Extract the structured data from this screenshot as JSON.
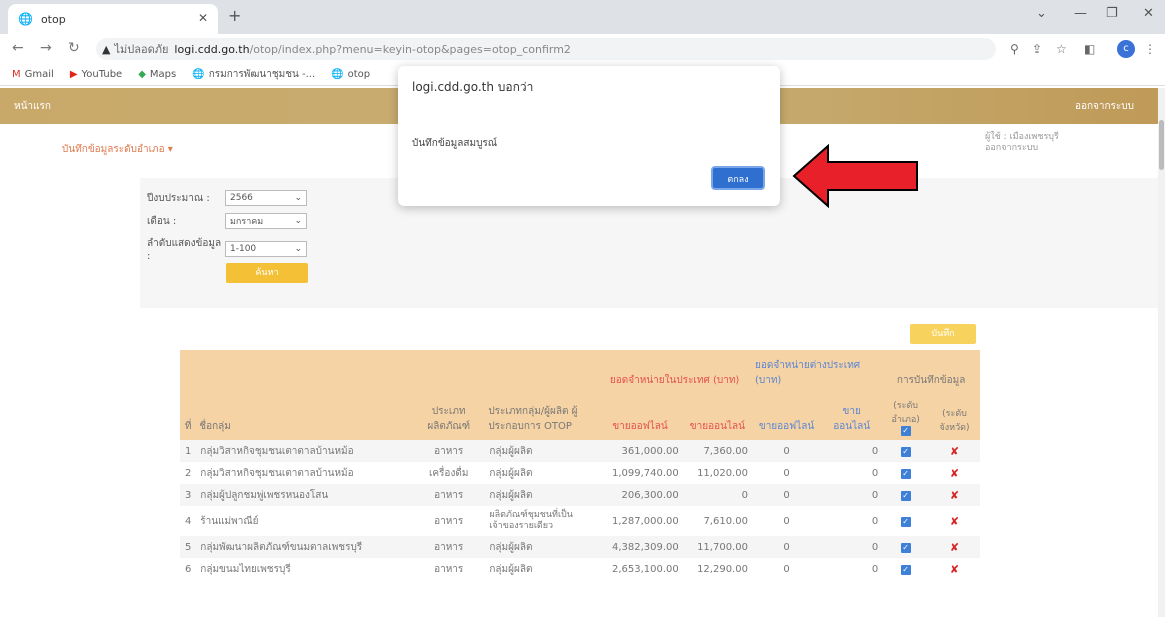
{
  "browser": {
    "tab_title": "otop",
    "url_warning": "ไม่ปลอดภัย",
    "url_domain": "logi.cdd.go.th",
    "url_path": "/otop/index.php?menu=keyin-otop&pages=otop_confirm2",
    "profile_letter": "c",
    "bookmarks": [
      "Gmail",
      "YouTube",
      "Maps",
      "กรมการพัฒนาชุมชน -...",
      "otop"
    ]
  },
  "site": {
    "home_label": "หน้าแรก",
    "logout_label": "ออกจากระบบ",
    "user_line1": "ผู้ใช้ : เมืองเพชรบุรี",
    "user_line2": "ออกจากระบบ",
    "menu_link": "บันทึกข้อมูลระดับอำเภอ ▾"
  },
  "filters": {
    "year_label": "ปีงบประมาณ :",
    "year_value": "2566",
    "month_label": "เดือน :",
    "month_value": "มกราคม",
    "order_label": "ลำดับแสดงข้อมูล :",
    "order_value": "1-100",
    "search_label": "ค้นหา"
  },
  "save_label": "บันทึก",
  "table": {
    "h_no": "ที่",
    "h_group": "ชื่อกลุ่ม",
    "h_type": "ประเภทผลิตภัณฑ์",
    "h_producer": "ประเภทกลุ่ม/ผู้ผลิต ผู้ประกอบการ OTOP",
    "h_domestic": "ยอดจำหน่ายในประเทศ (บาท)",
    "h_foreign": "ยอดจำหน่ายต่างประเทศ (บาท)",
    "h_record": "การบันทึกข้อมูล",
    "h_offline": "ขายออฟไลน์",
    "h_online": "ขายออนไลน์",
    "h_foffline": "ขายออฟไลน์",
    "h_fonline": "ขายออนไลน์",
    "h_district": "(ระดับอำเภอ)",
    "h_province": "(ระดับจังหวัด)",
    "rows": [
      {
        "no": "1",
        "name": "กลุ่มวิสาหกิจชุมชนเตาตาลบ้านหม้อ",
        "type": "อาหาร",
        "producer": "กลุ่มผู้ผลิต",
        "offline": "361,000.00",
        "online": "7,360.00",
        "foffline": "0",
        "fonline": "0"
      },
      {
        "no": "2",
        "name": "กลุ่มวิสาหกิจชุมชนเตาตาลบ้านหม้อ",
        "type": "เครื่องดื่ม",
        "producer": "กลุ่มผู้ผลิต",
        "offline": "1,099,740.00",
        "online": "11,020.00",
        "foffline": "0",
        "fonline": "0"
      },
      {
        "no": "3",
        "name": "กลุ่มผู้ปลูกชมพู่เพชรหนองโสน",
        "type": "อาหาร",
        "producer": "กลุ่มผู้ผลิต",
        "offline": "206,300.00",
        "online": "0",
        "foffline": "0",
        "fonline": "0"
      },
      {
        "no": "4",
        "name": "ร้านแม่พาณีย์",
        "type": "อาหาร",
        "producer": "ผลิตภัณฑ์ชุมชนที่เป็นเจ้าของรายเดียว",
        "offline": "1,287,000.00",
        "online": "7,610.00",
        "foffline": "0",
        "fonline": "0"
      },
      {
        "no": "5",
        "name": "กลุ่มพัฒนาผลิตภัณฑ์ขนมตาลเพชรบุรี",
        "type": "อาหาร",
        "producer": "กลุ่มผู้ผลิต",
        "offline": "4,382,309.00",
        "online": "11,700.00",
        "foffline": "0",
        "fonline": "0"
      },
      {
        "no": "6",
        "name": "กลุ่มขนมไทยเพชรบุรี",
        "type": "อาหาร",
        "producer": "กลุ่มผู้ผลิต",
        "offline": "2,653,100.00",
        "online": "12,290.00",
        "foffline": "0",
        "fonline": "0"
      }
    ]
  },
  "dialog": {
    "title": "logi.cdd.go.th บอกว่า",
    "message": "บันทึกข้อมูลสมบูรณ์",
    "ok_label": "ตกลง"
  }
}
